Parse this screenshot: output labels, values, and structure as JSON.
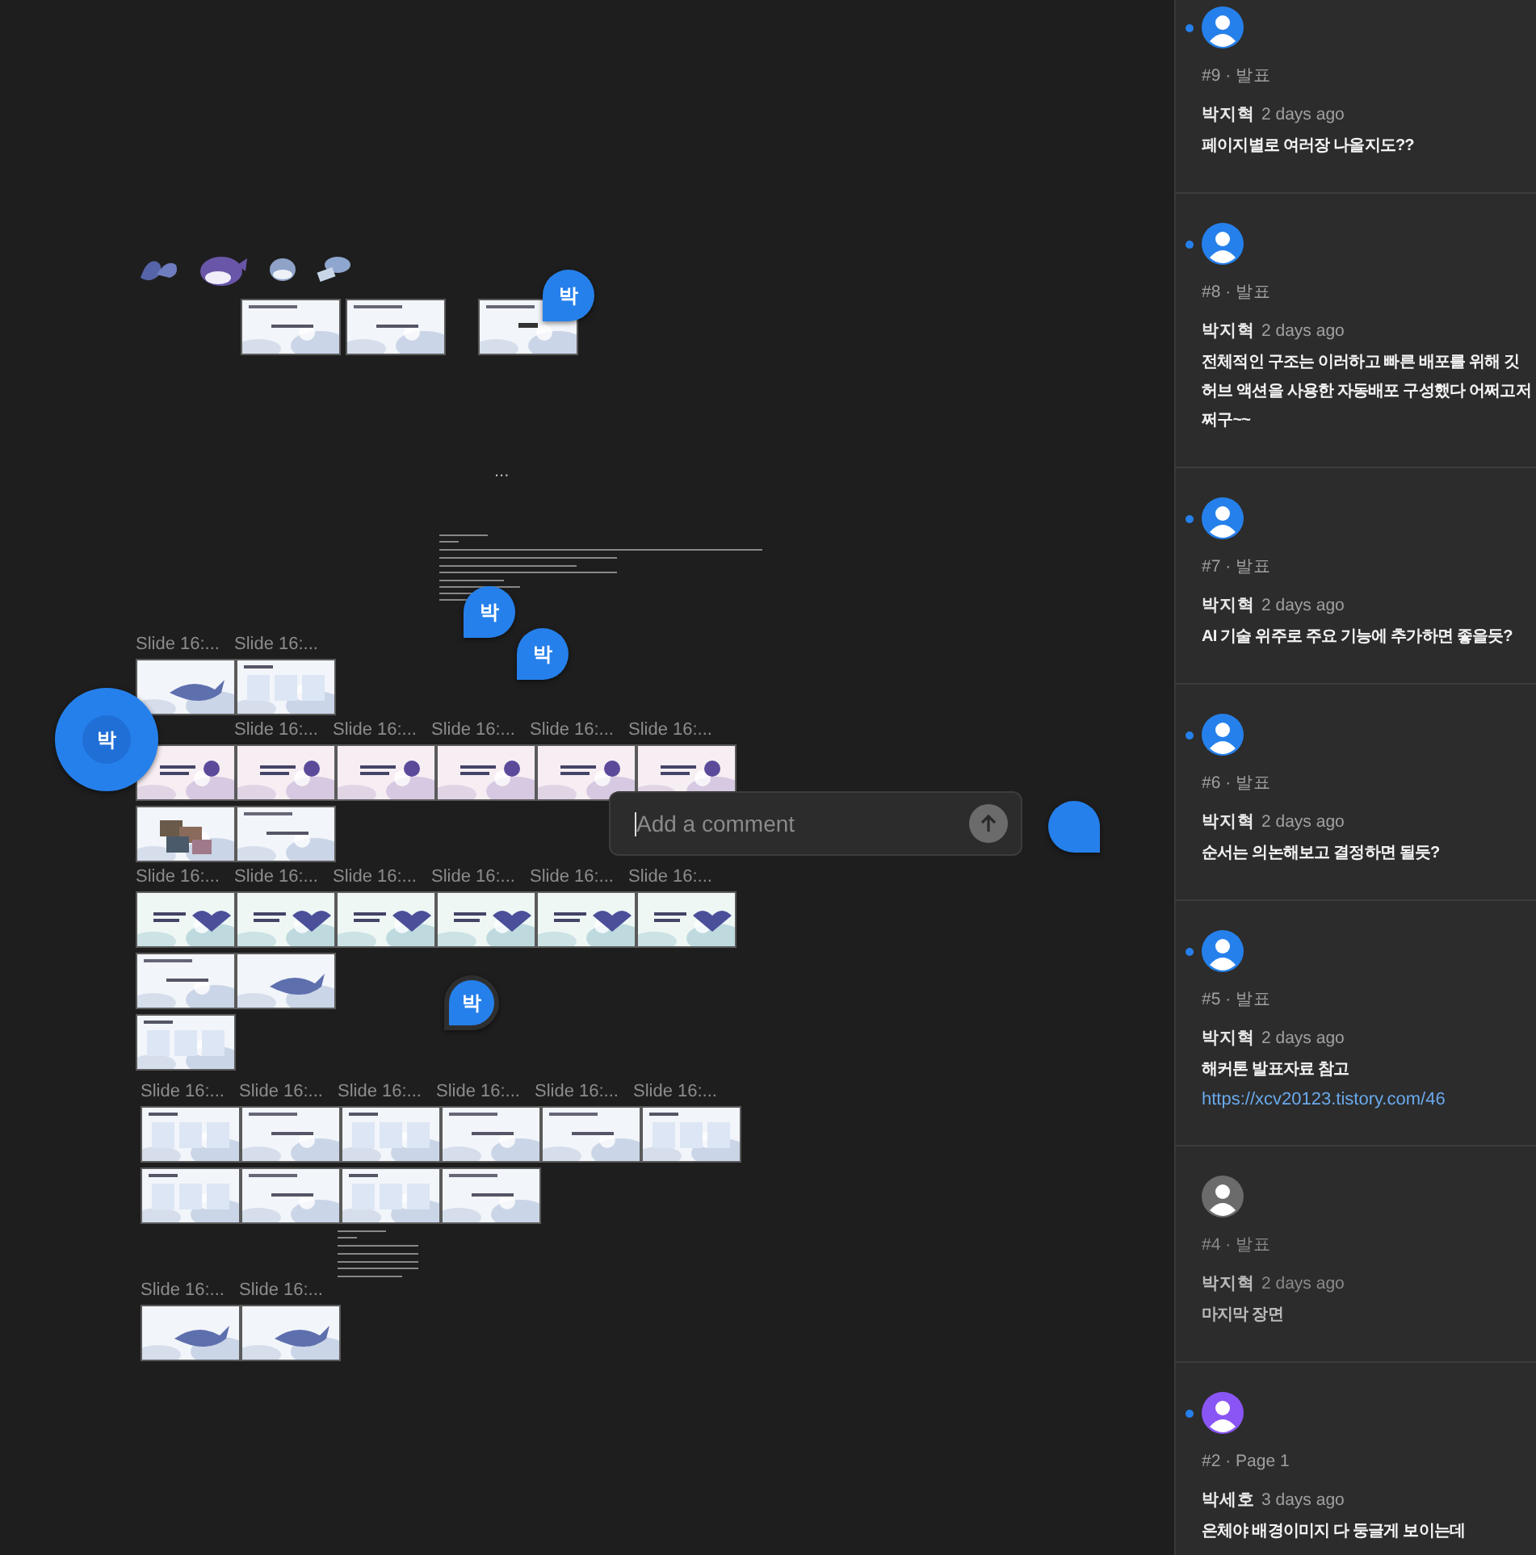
{
  "canvas": {
    "top_frames": [
      {
        "kind": "blue"
      },
      {
        "kind": "blue"
      },
      {
        "kind": "blue-title"
      }
    ],
    "ellipsis": "...",
    "frame_groups": [
      {
        "rows": [
          {
            "labels": [
              {
                "text": "Slide 16:..."
              },
              {
                "text": "Slide 16:..."
              }
            ]
          },
          {
            "thumbnails": [
              {
                "kind": "blue-whale"
              },
              {
                "kind": "blue-people"
              }
            ]
          },
          {
            "labels": [
              {
                "kind": "hidden"
              },
              {
                "text": "Slide 16:..."
              },
              {
                "text": "Slide 16:..."
              },
              {
                "text": "Slide 16:..."
              },
              {
                "text": "Slide 16:..."
              },
              {
                "text": "Slide 16:..."
              }
            ]
          },
          {
            "thumbnails": [
              {
                "kind": "pink"
              },
              {
                "kind": "pink"
              },
              {
                "kind": "pink"
              },
              {
                "kind": "pink"
              },
              {
                "kind": "pink"
              },
              {
                "kind": "pink"
              }
            ]
          },
          {
            "thumbnails": [
              {
                "kind": "blue-photos"
              },
              {
                "kind": "blue"
              }
            ]
          },
          {
            "labels": [
              {
                "text": "Slide 16:..."
              },
              {
                "text": "Slide 16:..."
              },
              {
                "text": "Slide 16:..."
              },
              {
                "text": "Slide 16:..."
              },
              {
                "text": "Slide 16:..."
              },
              {
                "text": "Slide 16:..."
              }
            ]
          },
          {
            "thumbnails": [
              {
                "kind": "mint"
              },
              {
                "kind": "mint"
              },
              {
                "kind": "mint"
              },
              {
                "kind": "mint"
              },
              {
                "kind": "mint"
              },
              {
                "kind": "mint"
              }
            ]
          },
          {
            "thumbnails": [
              {
                "kind": "blue"
              },
              {
                "kind": "blue-whale"
              }
            ]
          },
          {
            "thumbnails": [
              {
                "kind": "blue-people"
              }
            ]
          }
        ]
      },
      {
        "rows": [
          {
            "labels": [
              {
                "text": "Slide 16:..."
              },
              {
                "text": "Slide 16:..."
              },
              {
                "text": "Slide 16:..."
              },
              {
                "text": "Slide 16:..."
              },
              {
                "text": "Slide 16:..."
              },
              {
                "text": "Slide 16:..."
              }
            ]
          },
          {
            "thumbnails": [
              {
                "kind": "blue-people"
              },
              {
                "kind": "blue"
              },
              {
                "kind": "blue-people"
              },
              {
                "kind": "blue"
              },
              {
                "kind": "blue"
              },
              {
                "kind": "blue-people"
              }
            ]
          },
          {
            "thumbnails": [
              {
                "kind": "blue-people"
              },
              {
                "kind": "blue"
              },
              {
                "kind": "blue-people"
              },
              {
                "kind": "blue"
              }
            ]
          },
          {
            "labels": [
              {
                "text": "Slide 16:..."
              },
              {
                "text": "Slide 16:..."
              }
            ]
          },
          {
            "thumbnails": [
              {
                "kind": "blue-whale"
              },
              {
                "kind": "blue-whale"
              }
            ]
          }
        ]
      }
    ],
    "pins": [
      {
        "kind": "small",
        "initial": "박"
      },
      {
        "kind": "small",
        "initial": "박"
      },
      {
        "kind": "small",
        "initial": "박"
      },
      {
        "kind": "large",
        "initial": "박"
      },
      {
        "kind": "ringed",
        "initial": "박"
      },
      {
        "kind": "empty"
      }
    ],
    "comment_input": {
      "placeholder": "Add a comment"
    }
  },
  "comments": [
    {
      "header": "#9 · 발표",
      "author": "박지혁",
      "time": "2 days ago",
      "body": "페이지별로 여러장 나올지도??",
      "unread": true,
      "color": "#2680eb"
    },
    {
      "header": "#8 · 발표",
      "author": "박지혁",
      "time": "2 days ago",
      "body": "전체적인 구조는 이러하고 빠른 배포를 위해 깃허브 액션을 사용한 자동배포 구성했다 어쩌고저쩌구~~",
      "unread": true,
      "color": "#2680eb"
    },
    {
      "header": "#7 · 발표",
      "author": "박지혁",
      "time": "2 days ago",
      "body": "AI 기술 위주로 주요 기능에 추가하면 좋을듯?",
      "unread": true,
      "color": "#2680eb"
    },
    {
      "header": "#6 · 발표",
      "author": "박지혁",
      "time": "2 days ago",
      "body": "순서는 의논해보고 결정하면 될듯?",
      "unread": true,
      "color": "#2680eb"
    },
    {
      "header": "#5 · 발표",
      "author": "박지혁",
      "time": "2 days ago",
      "body": "해커톤 발표자료 참고",
      "link": "https://xcv20123.tistory.com/46",
      "unread": true,
      "color": "#2680eb"
    },
    {
      "header": "#4 · 발표",
      "author": "박지혁",
      "time": "2 days ago",
      "body": "마지막 장면",
      "unread": false,
      "color": "#6b6b6b"
    },
    {
      "header": "#2 · Page 1",
      "author": "박세호",
      "time": "3 days ago",
      "body": "은체야 배경이미지 다 둥글게 보이는데",
      "unread": true,
      "color": "#8a55f5"
    }
  ]
}
